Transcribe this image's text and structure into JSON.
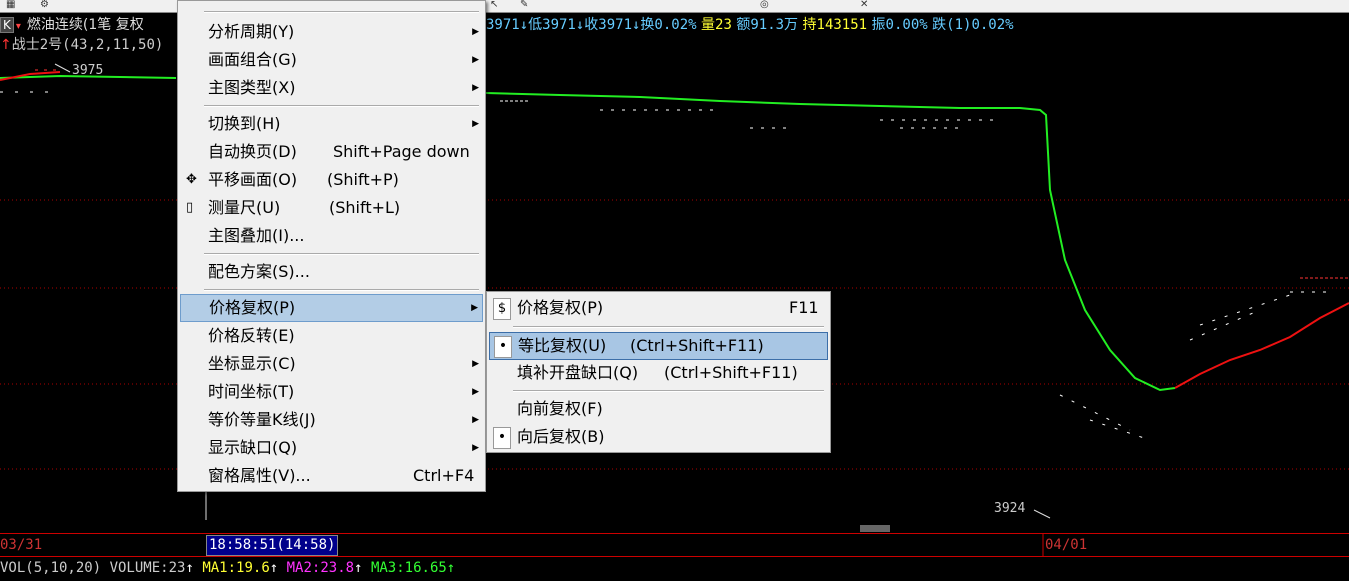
{
  "quote": {
    "symbol_prefix": "K",
    "title": "燃油连续(1笔 复权",
    "low": "3971↓低3971↓收3971↓换0.02%",
    "vol": "量23",
    "amount": "额91.3万",
    "oi": "持143151",
    "amp": "振0.00%",
    "chg": "跌(1)0.02%"
  },
  "indicator": {
    "arrow": "↑",
    "name": "战士2号(43,2,11,50)"
  },
  "price_labels": {
    "high": "3975",
    "low": "3924"
  },
  "axis": {
    "date_left": "03/31",
    "date_right": "04/01",
    "cursor_time": "18:58:51(14:58)"
  },
  "volume_bar": {
    "vol": "VOL(5,10,20) VOLUME:23",
    "ma1": "MA1:19.6",
    "ma2": "MA2:23.8",
    "ma3": "MA3:16.65",
    "up_arrow": "↑"
  },
  "colors": {
    "green_line": "#22ee22",
    "red_line": "#ee1111",
    "grid": "#aa0000",
    "ma1": "#ffff33",
    "ma2": "#ff33ff",
    "ma3": "#33ff33"
  },
  "main_menu": {
    "items": [
      {
        "label": "分析周期(Y)",
        "shortcut": "",
        "submenu": true
      },
      {
        "label": "画面组合(G)",
        "shortcut": "",
        "submenu": true
      },
      {
        "label": "主图类型(X)",
        "shortcut": "",
        "submenu": true
      },
      {
        "label": "切换到(H)",
        "shortcut": "",
        "submenu": true
      },
      {
        "label": "自动换页(D)",
        "shortcut": "Shift+Page down",
        "submenu": false
      },
      {
        "label": "平移画面(O)",
        "shortcut": "(Shift+P)",
        "submenu": false,
        "icon": "move-icon"
      },
      {
        "label": "测量尺(U)",
        "shortcut": "(Shift+L)",
        "submenu": false,
        "icon": "ruler-icon"
      },
      {
        "label": "主图叠加(I)...",
        "shortcut": "",
        "submenu": false
      },
      {
        "label": "配色方案(S)...",
        "shortcut": "",
        "submenu": false
      },
      {
        "label": "价格复权(P)",
        "shortcut": "",
        "submenu": true
      },
      {
        "label": "价格反转(E)",
        "shortcut": "",
        "submenu": false
      },
      {
        "label": "坐标显示(C)",
        "shortcut": "",
        "submenu": true
      },
      {
        "label": "时间坐标(T)",
        "shortcut": "",
        "submenu": true
      },
      {
        "label": "等价等量K线(J)",
        "shortcut": "",
        "submenu": true
      },
      {
        "label": "显示缺口(Q)",
        "shortcut": "",
        "submenu": true
      },
      {
        "label": "窗格属性(V)...",
        "shortcut": "Ctrl+F4",
        "submenu": false
      }
    ]
  },
  "sub_menu": {
    "items": [
      {
        "label": "价格复权(P)",
        "shortcut": "F11",
        "icon": "$"
      },
      {
        "label": "等比复权(U)",
        "shortcut": "(Ctrl+Shift+F11)",
        "checked": true
      },
      {
        "label": "填补开盘缺口(Q)",
        "shortcut": "(Ctrl+Shift+F11)",
        "checked": false
      },
      {
        "label": "向前复权(F)",
        "shortcut": "",
        "checked": false
      },
      {
        "label": "向后复权(B)",
        "shortcut": "",
        "checked": true
      }
    ]
  }
}
